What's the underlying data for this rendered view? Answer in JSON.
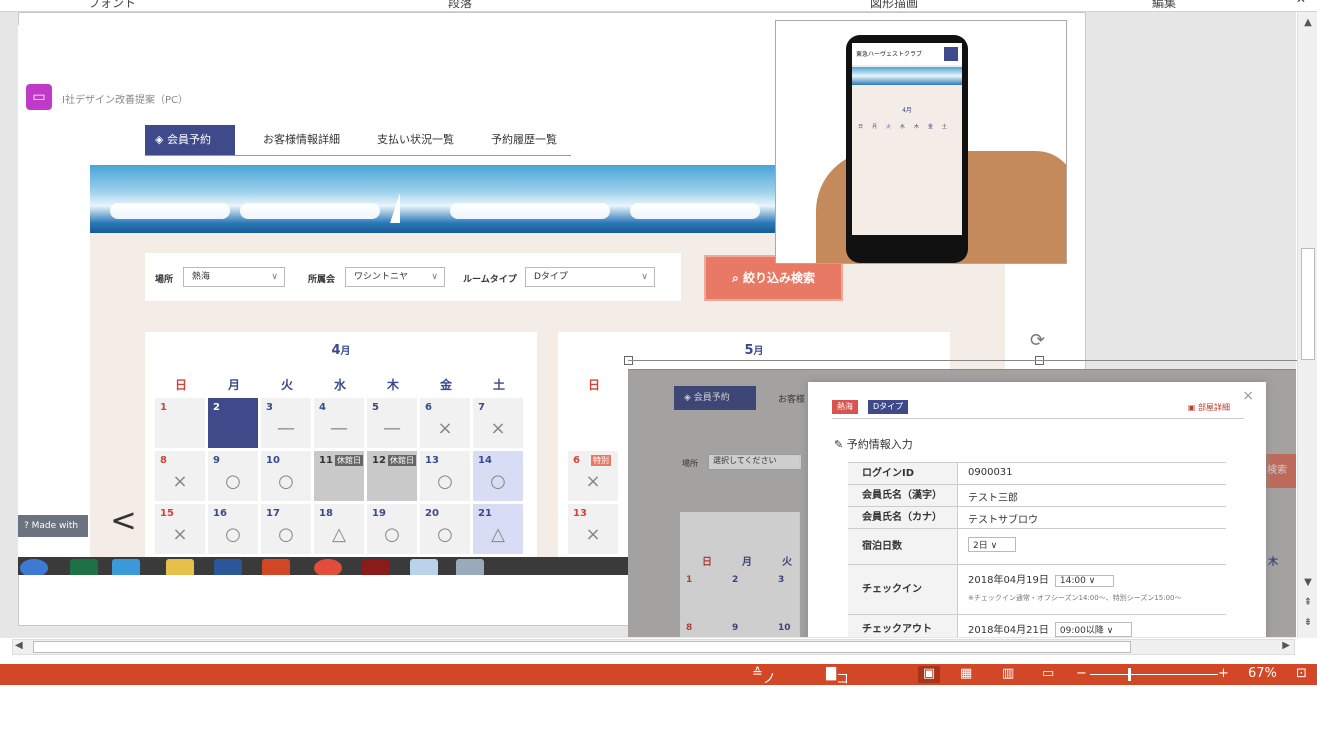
{
  "ribbon": {
    "groups": [
      "フォント",
      "段落",
      "図形描画",
      "編集"
    ]
  },
  "status_bar": {
    "note": "ノート",
    "comment": "コメント",
    "zoom": "67%",
    "zoom_minus": "−",
    "zoom_plus": "+"
  },
  "web": {
    "project_label": "I社デザイン改善提案（PC）",
    "tabs": [
      "会員予約",
      "お客様情報詳細",
      "支払い状況一覧",
      "予約履歴一覧"
    ],
    "filter": {
      "location_label": "場所",
      "location_value": "熱海",
      "club_label": "所属会",
      "club_value": "ワシントニヤ",
      "room_label": "ルームタイプ",
      "room_value": "Dタイプ",
      "search_button": "絞り込み検索"
    },
    "calendar1": {
      "month": "4",
      "month_suffix": "月",
      "weekdays": [
        "日",
        "月",
        "火",
        "水",
        "木",
        "金",
        "土"
      ],
      "cells": [
        {
          "d": "1",
          "m": ""
        },
        {
          "d": "2",
          "m": "",
          "sel": true
        },
        {
          "d": "3",
          "m": "—"
        },
        {
          "d": "4",
          "m": "—"
        },
        {
          "d": "5",
          "m": "—"
        },
        {
          "d": "6",
          "m": "×"
        },
        {
          "d": "7",
          "m": "×"
        },
        {
          "d": "8",
          "m": "×"
        },
        {
          "d": "9",
          "m": "○"
        },
        {
          "d": "10",
          "m": "○"
        },
        {
          "d": "11",
          "m": "",
          "badge": "休館日"
        },
        {
          "d": "12",
          "m": "",
          "badge": "休館日"
        },
        {
          "d": "13",
          "m": "○"
        },
        {
          "d": "14",
          "m": "○"
        },
        {
          "d": "15",
          "m": "×"
        },
        {
          "d": "16",
          "m": "○"
        },
        {
          "d": "17",
          "m": "○"
        },
        {
          "d": "18",
          "m": "△"
        },
        {
          "d": "19",
          "m": "○"
        },
        {
          "d": "20",
          "m": "○"
        },
        {
          "d": "21",
          "m": "△"
        }
      ]
    },
    "calendar2": {
      "month": "5",
      "month_suffix": "月",
      "first_weekday": "日",
      "cells": [
        {
          "d": "6",
          "badge": "特別",
          "m": "×"
        },
        {
          "d": "13",
          "m": "×"
        }
      ]
    },
    "made_with": "Made with"
  },
  "modal": {
    "tags": [
      "熱海",
      "Dタイプ"
    ],
    "room_detail": "部屋詳細",
    "title": "予約情報入力",
    "rows": [
      {
        "k": "ログインID",
        "v": "0900031"
      },
      {
        "k": "会員氏名（漢字）",
        "v": "テスト三郎"
      },
      {
        "k": "会員氏名（カナ）",
        "v": "テストサブロウ"
      },
      {
        "k": "宿泊日数",
        "v": "2日"
      },
      {
        "k": "チェックイン",
        "v": "2018年04月19日",
        "time": "14:00",
        "note": "※チェックイン通常・オフシーズン14:00〜、特別シーズン15:00〜"
      },
      {
        "k": "チェックアウト",
        "v": "2018年04月21日",
        "time": "09:00以降"
      }
    ],
    "bg_tab": "会員予約",
    "bg_tab2": "お客様",
    "bg_location_label": "場所",
    "bg_location_placeholder": "選択してください",
    "bg_search": "検索",
    "bg_weekdays": [
      "日",
      "月",
      "火"
    ],
    "bg_weekday_right": "木",
    "bg_days": [
      "1",
      "2",
      "3",
      "8",
      "9",
      "10"
    ]
  },
  "phone": {
    "brand": "東急ハーヴェストクラブ",
    "month": "4月",
    "weekdays": [
      "日",
      "月",
      "火",
      "水",
      "木",
      "金",
      "土"
    ]
  }
}
